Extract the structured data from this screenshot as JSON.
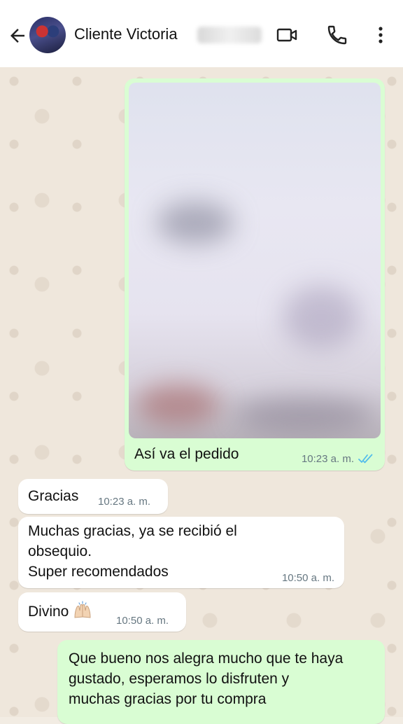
{
  "header": {
    "contact_name": "Cliente Victoria"
  },
  "messages": [
    {
      "type": "image",
      "direction": "outgoing",
      "caption": "Así va el pedido",
      "time": "10:23 a. m.",
      "status": "read"
    },
    {
      "type": "text",
      "direction": "incoming",
      "text": "Gracias",
      "time": "10:23 a. m."
    },
    {
      "type": "text",
      "direction": "incoming",
      "lines": [
        "Muchas gracias, ya se recibió el",
        "obsequio.",
        "Super recomendados"
      ],
      "time": "10:50 a. m."
    },
    {
      "type": "text",
      "direction": "incoming",
      "text": "Divino",
      "emoji": "raising-hands",
      "time": "10:50 a. m."
    },
    {
      "type": "text",
      "direction": "outgoing",
      "lines": [
        "Que bueno nos alegra mucho que te haya",
        "gustado, esperamos lo disfruten y",
        "muchas gracias por tu compra"
      ]
    }
  ],
  "colors": {
    "outgoing_bubble": "#d9fdd3",
    "incoming_bubble": "#ffffff",
    "read_ticks": "#53bdeb",
    "chat_background": "#efe7dc"
  }
}
